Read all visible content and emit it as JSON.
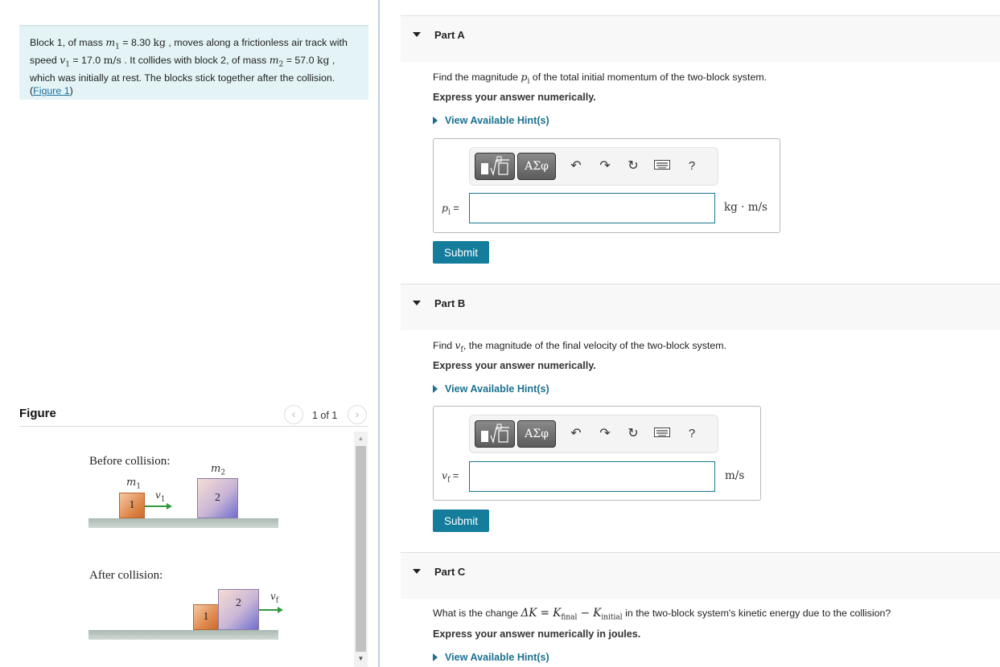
{
  "problem": {
    "text_1": "Block 1, of mass ",
    "m1_symbol": "m",
    "m1_sub": "1",
    "m1_value": " = 8.30 ",
    "kg_unit": "kg",
    "text_2": " , moves along a frictionless air track with speed ",
    "v1_symbol": "v",
    "v1_sub": "1",
    "v1_value": " = 17.0 ",
    "ms_unit": "m/s",
    "text_3": " . It collides with block 2, of mass ",
    "m2_symbol": "m",
    "m2_sub": "2",
    "m2_value": " = 57.0 ",
    "kg_unit_2": "kg",
    "text_4": " , which was initially at rest. The blocks stick together after the collision. (",
    "figure_link": "Figure 1",
    "text_5": ")"
  },
  "figure": {
    "title": "Figure",
    "pager_text": "1 of 1",
    "prev_icon": "chevron-left-icon",
    "next_icon": "chevron-right-icon",
    "before_label": "Before collision:",
    "after_label": "After collision:",
    "m1_label": "m",
    "m1_sub": "1",
    "m2_label": "m",
    "m2_sub": "2",
    "v1_label": "v",
    "v1_sub": "1",
    "vf_label": "v",
    "vf_sub": "f",
    "block1_number": "1",
    "block2_number": "2"
  },
  "toolbar": {
    "template_icon": "fraction-root-template-icon",
    "greek_label": "ΑΣφ",
    "undo_icon": "undo-icon",
    "redo_icon": "redo-icon",
    "reset_icon": "reset-icon",
    "keyboard_icon": "keyboard-icon",
    "help_label": "?"
  },
  "parts": [
    {
      "title": "Part A",
      "question_pre": "Find the magnitude ",
      "question_symbol": "p",
      "question_sub": "i",
      "question_post": " of the total initial momentum of the two-block system.",
      "instruction": "Express your answer numerically.",
      "hint_label": "View Available Hint(s)",
      "answer_symbol": "p",
      "answer_sub": "i",
      "answer_eq": " =",
      "answer_value": "",
      "unit": "kg · m/s",
      "submit_label": "Submit"
    },
    {
      "title": "Part B",
      "question_pre": "Find ",
      "question_symbol": "v",
      "question_sub": "f",
      "question_post": ", the magnitude of the final velocity of the two-block system.",
      "instruction": "Express your answer numerically.",
      "hint_label": "View Available Hint(s)",
      "answer_symbol": "v",
      "answer_sub": "f",
      "answer_eq": " =",
      "answer_value": "",
      "unit": "m/s",
      "submit_label": "Submit"
    },
    {
      "title": "Part C",
      "question_pre": "What is the change ",
      "question_math": "ΔK = K",
      "question_sub1": "final",
      "question_math2": " − K",
      "question_sub2": "initial",
      "question_post": " in the two-block system's kinetic energy due to the collision?",
      "instruction": "Express your answer numerically in joules.",
      "hint_label": "View Available Hint(s)"
    }
  ]
}
